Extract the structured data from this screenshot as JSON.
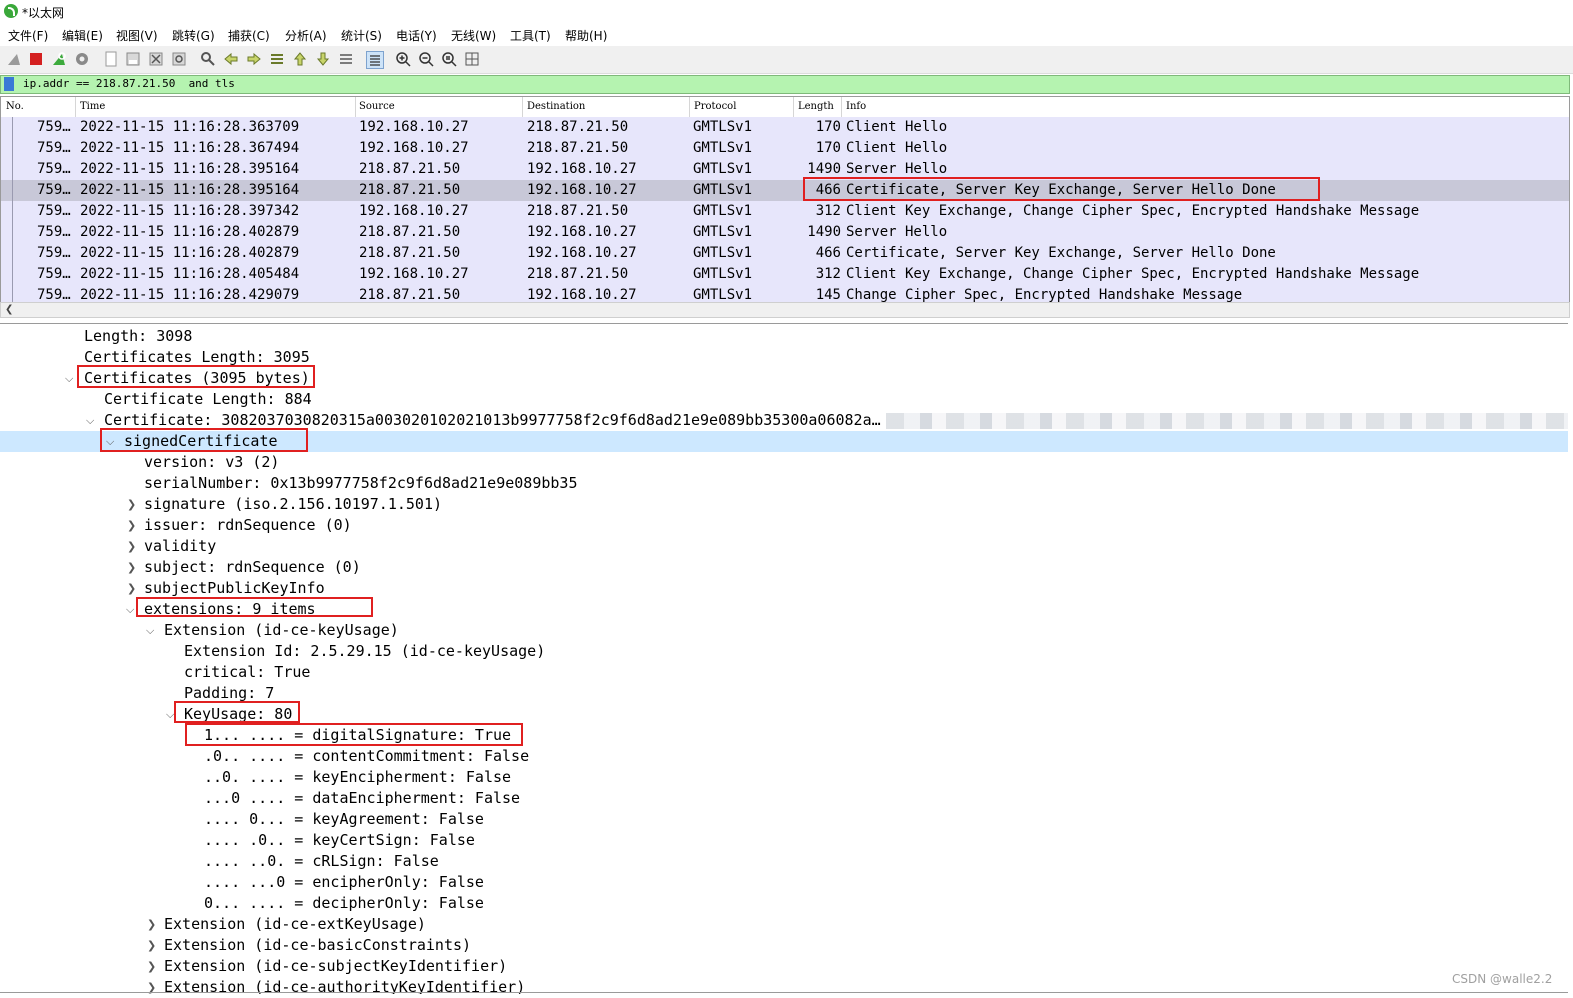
{
  "window": {
    "title": "*以太网"
  },
  "menu": [
    "文件(F)",
    "编辑(E)",
    "视图(V)",
    "跳转(G)",
    "捕获(C)",
    "分析(A)",
    "统计(S)",
    "电话(Y)",
    "无线(W)",
    "工具(T)",
    "帮助(H)"
  ],
  "toolbar": {
    "icons": [
      "shark-fin-icon",
      "stop-icon",
      "restart-icon",
      "options-gear-icon",
      "open-file-icon",
      "save-icon",
      "close-file-icon",
      "reload-icon",
      "find-icon",
      "back-arrow-icon",
      "forward-arrow-icon",
      "goto-packet-icon",
      "first-packet-icon",
      "last-packet-icon",
      "autoscroll-icon",
      "colorize-icon",
      "zoom-in-icon",
      "zoom-out-icon",
      "normal-size-icon",
      "resize-columns-icon"
    ]
  },
  "filter": {
    "value": "ip.addr == 218.87.21.50  and tls"
  },
  "packet_list": {
    "columns": [
      "No.",
      "Time",
      "Source",
      "Destination",
      "Protocol",
      "Length",
      "Info"
    ],
    "rows": [
      {
        "no": "759…",
        "time": "2022-11-15 11:16:28.363709",
        "src": "192.168.10.27",
        "dst": "218.87.21.50",
        "proto": "GMTLSv1",
        "len": "170",
        "info": "Client Hello"
      },
      {
        "no": "759…",
        "time": "2022-11-15 11:16:28.367494",
        "src": "192.168.10.27",
        "dst": "218.87.21.50",
        "proto": "GMTLSv1",
        "len": "170",
        "info": "Client Hello"
      },
      {
        "no": "759…",
        "time": "2022-11-15 11:16:28.395164",
        "src": "218.87.21.50",
        "dst": "192.168.10.27",
        "proto": "GMTLSv1",
        "len": "1490",
        "info": "Server Hello"
      },
      {
        "no": "759…",
        "time": "2022-11-15 11:16:28.395164",
        "src": "218.87.21.50",
        "dst": "192.168.10.27",
        "proto": "GMTLSv1",
        "len": "466",
        "info": "Certificate, Server Key Exchange, Server Hello Done"
      },
      {
        "no": "759…",
        "time": "2022-11-15 11:16:28.397342",
        "src": "192.168.10.27",
        "dst": "218.87.21.50",
        "proto": "GMTLSv1",
        "len": "312",
        "info": "Client Key Exchange, Change Cipher Spec, Encrypted Handshake Message"
      },
      {
        "no": "759…",
        "time": "2022-11-15 11:16:28.402879",
        "src": "218.87.21.50",
        "dst": "192.168.10.27",
        "proto": "GMTLSv1",
        "len": "1490",
        "info": "Server Hello"
      },
      {
        "no": "759…",
        "time": "2022-11-15 11:16:28.402879",
        "src": "218.87.21.50",
        "dst": "192.168.10.27",
        "proto": "GMTLSv1",
        "len": "466",
        "info": "Certificate, Server Key Exchange, Server Hello Done"
      },
      {
        "no": "759…",
        "time": "2022-11-15 11:16:28.405484",
        "src": "192.168.10.27",
        "dst": "218.87.21.50",
        "proto": "GMTLSv1",
        "len": "312",
        "info": "Client Key Exchange, Change Cipher Spec, Encrypted Handshake Message"
      },
      {
        "no": "759…",
        "time": "2022-11-15 11:16:28.429079",
        "src": "218.87.21.50",
        "dst": "192.168.10.27",
        "proto": "GMTLSv1",
        "len": "145",
        "info": "Change Cipher Spec, Encrypted Handshake Message"
      }
    ]
  },
  "details": {
    "lines": [
      {
        "text": "Length: 3098",
        "arrow": ""
      },
      {
        "text": "Certificates Length: 3095",
        "arrow": ""
      },
      {
        "text": "Certificates (3095 bytes)",
        "arrow": "open"
      },
      {
        "text": "Certificate Length: 884",
        "arrow": ""
      },
      {
        "text": "Certificate: 3082037030820315a003020102021013b9977758f2c9f6d8ad21e9e089bb35300a06082a…",
        "arrow": "open"
      },
      {
        "text": "signedCertificate",
        "arrow": "open"
      },
      {
        "text": "version: v3 (2)",
        "arrow": ""
      },
      {
        "text": "serialNumber: 0x13b9977758f2c9f6d8ad21e9e089bb35",
        "arrow": ""
      },
      {
        "text": "signature (iso.2.156.10197.1.501)",
        "arrow": "closed"
      },
      {
        "text": "issuer: rdnSequence (0)",
        "arrow": "closed"
      },
      {
        "text": "validity",
        "arrow": "closed"
      },
      {
        "text": "subject: rdnSequence (0)",
        "arrow": "closed"
      },
      {
        "text": "subjectPublicKeyInfo",
        "arrow": "closed"
      },
      {
        "text": "extensions: 9 items",
        "arrow": "open"
      },
      {
        "text": "Extension (id-ce-keyUsage)",
        "arrow": "open"
      },
      {
        "text": "Extension Id: 2.5.29.15 (id-ce-keyUsage)",
        "arrow": ""
      },
      {
        "text": "critical: True",
        "arrow": ""
      },
      {
        "text": "Padding: 7",
        "arrow": ""
      },
      {
        "text": "KeyUsage: 80",
        "arrow": "open"
      },
      {
        "text": "1... .... = digitalSignature: True",
        "arrow": ""
      },
      {
        "text": ".0.. .... = contentCommitment: False",
        "arrow": ""
      },
      {
        "text": "..0. .... = keyEncipherment: False",
        "arrow": ""
      },
      {
        "text": "...0 .... = dataEncipherment: False",
        "arrow": ""
      },
      {
        "text": ".... 0... = keyAgreement: False",
        "arrow": ""
      },
      {
        "text": ".... .0.. = keyCertSign: False",
        "arrow": ""
      },
      {
        "text": ".... ..0. = cRLSign: False",
        "arrow": ""
      },
      {
        "text": ".... ...0 = encipherOnly: False",
        "arrow": ""
      },
      {
        "text": "0... .... = decipherOnly: False",
        "arrow": ""
      },
      {
        "text": "Extension (id-ce-extKeyUsage)",
        "arrow": "closed"
      },
      {
        "text": "Extension (id-ce-basicConstraints)",
        "arrow": "closed"
      },
      {
        "text": "Extension (id-ce-subjectKeyIdentifier)",
        "arrow": "closed"
      },
      {
        "text": "Extension (id-ce-authorityKeyIdentifier)",
        "arrow": "closed"
      }
    ]
  },
  "watermark": "CSDN @walle2.2",
  "colors": {
    "packet_row_bg": "#e7e6fb",
    "selected_row_bg": "#c8c8d8",
    "filter_bg": "#b5f3b0",
    "detail_selected_bg": "#cde8ff",
    "highlight_box": "#e02020"
  }
}
